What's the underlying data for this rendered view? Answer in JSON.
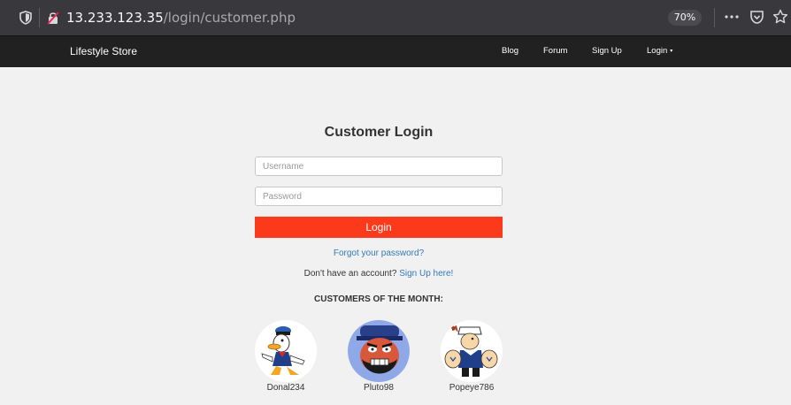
{
  "browser": {
    "url_host": "13.233.123.35",
    "url_path": "/login/customer.php",
    "zoom": "70%",
    "icons": [
      "shield-icon",
      "insecure-lock-icon",
      "more-icon",
      "pocket-icon",
      "bookmark-star-icon"
    ]
  },
  "nav": {
    "brand": "Lifestyle Store",
    "links": [
      "Blog",
      "Forum",
      "Sign Up",
      "Login"
    ],
    "login_caret": "▾"
  },
  "login": {
    "title": "Customer Login",
    "username_placeholder": "Username",
    "password_placeholder": "Password",
    "button": "Login",
    "forgot": "Forgot your password?",
    "no_account": "Don't have an account?",
    "signup_link": "Sign Up here!"
  },
  "customers": {
    "heading": "CUSTOMERS OF THE MONTH:",
    "names": [
      "Donal234",
      "Pluto98",
      "Popeye786"
    ]
  },
  "colors": {
    "navbar": "#212121",
    "button": "#fb391b",
    "link": "#337ab7",
    "background": "#f1f1f1"
  }
}
